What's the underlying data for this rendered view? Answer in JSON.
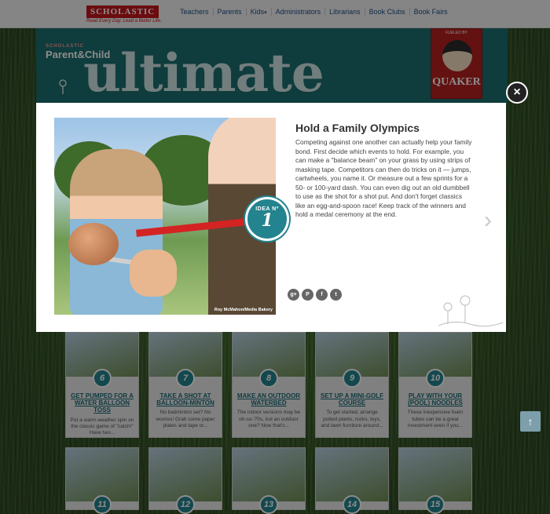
{
  "header": {
    "logo": "SCHOLASTIC",
    "tagline": "Read Every Day. Lead a Better Life.",
    "nav": [
      {
        "label": "Teachers"
      },
      {
        "label": "Parents"
      },
      {
        "label": "Kids"
      },
      {
        "label": "Administrators"
      },
      {
        "label": "Librarians"
      },
      {
        "label": "Book Clubs"
      },
      {
        "label": "Book Fairs"
      }
    ]
  },
  "banner": {
    "brand_small": "SCHOLASTIC",
    "brand": "Parent&Child",
    "title": "ultimate",
    "sponsor_fueled": "FUELED BY",
    "sponsor": "QUAKER"
  },
  "cards": [
    {
      "num": "6",
      "title": "GET PUMPED FOR A WATER BALLOON TOSS",
      "desc": "Put a warm-weather spin on the classic game of \"catch!\" Have two..."
    },
    {
      "num": "7",
      "title": "TAKE A SHOT AT BALLOON-MINTON",
      "desc": "No badminton set? No worries! Grab some paper plates and tape or..."
    },
    {
      "num": "8",
      "title": "MAKE AN OUTDOOR WATERBED",
      "desc": "The indoor versions may be oh-so-'70s, but an outdoor one? Now that's..."
    },
    {
      "num": "9",
      "title": "SET UP A MINI-GOLF COURSE",
      "desc": "To get started, arrange potted plants, rocks, toys, and lawn furniture around..."
    },
    {
      "num": "10",
      "title": "PLAY WITH YOUR (POOL) NOODLES",
      "desc": "These inexpensive foam tubes can be a great investment even if you..."
    },
    {
      "num": "11"
    },
    {
      "num": "12"
    },
    {
      "num": "13"
    },
    {
      "num": "14"
    },
    {
      "num": "15"
    }
  ],
  "modal": {
    "badge_label": "IDEA Nº",
    "badge_number": "1",
    "photo_credit": "Roy McMahon/Media Bakery",
    "title": "Hold a Family Olympics",
    "body": "Competing against one another can actually help your family bond. First decide which events to hold. For example, you can make a \"balance beam\" on your grass by using strips of masking tape. Competitors can then do tricks on it — jumps, cartwheels, you name it. Or measure out a few sprints for a 50- or 100-yard dash. You can even dig out an old dumbbell to use as the shot for a shot put. And don't forget classics like an egg-and-spoon race! Keep track of the winners and hold a medal ceremony at the end.",
    "close": "×",
    "next": "›",
    "share": [
      "g+",
      "P",
      "f",
      "t"
    ]
  },
  "scroll_top": "↑"
}
